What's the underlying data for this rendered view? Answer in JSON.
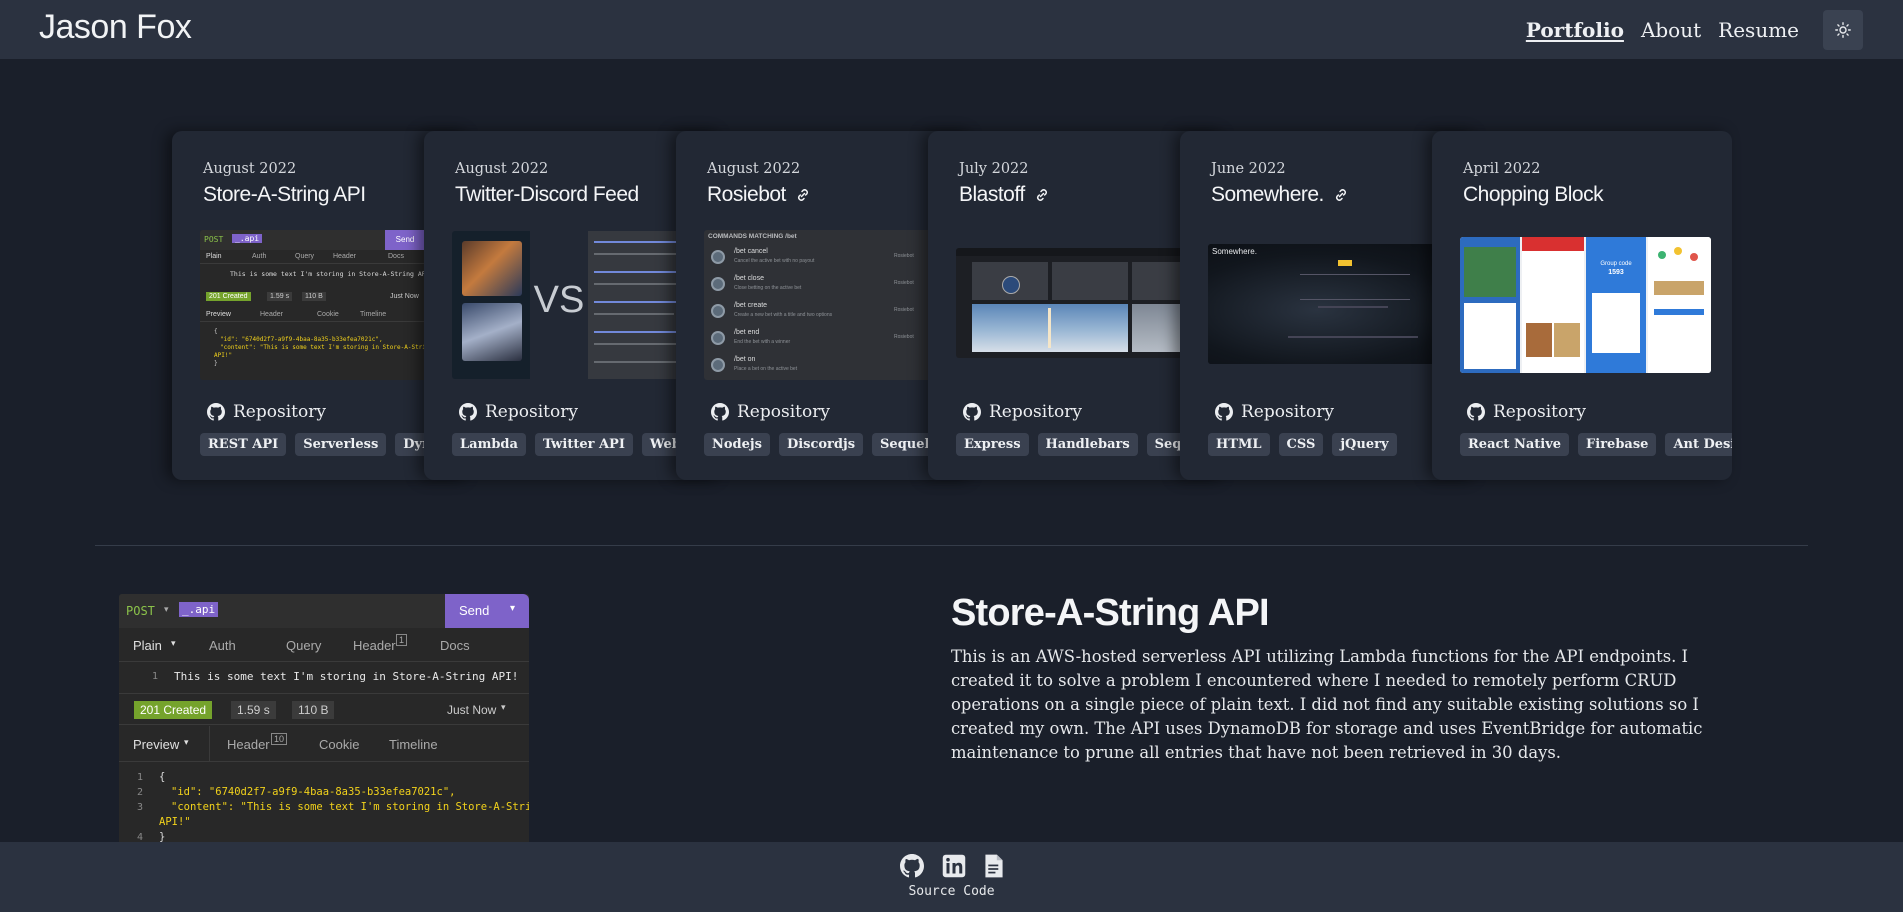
{
  "brand": "Jason Fox",
  "nav": {
    "portfolio": "Portfolio",
    "about": "About",
    "resume": "Resume"
  },
  "theme_toggle_icon": "sun-icon",
  "repo_label": "Repository",
  "cards": [
    {
      "date": "August 2022",
      "title": "Store-A-String API",
      "tags": [
        "REST API",
        "Serverless",
        "DynamoDB"
      ]
    },
    {
      "date": "August 2022",
      "title": "Twitter-Discord Feed",
      "vs": "VS",
      "tags": [
        "Lambda",
        "Twitter API",
        "Webhooks"
      ]
    },
    {
      "date": "August 2022",
      "title": "Rosiebot",
      "tags": [
        "Nodejs",
        "Discordjs",
        "Sequelize"
      ]
    },
    {
      "date": "July 2022",
      "title": "Blastoff",
      "tags": [
        "Express",
        "Handlebars",
        "Sequelize"
      ]
    },
    {
      "date": "June 2022",
      "title": "Somewhere.",
      "tags": [
        "HTML",
        "CSS",
        "jQuery"
      ]
    },
    {
      "date": "April 2022",
      "title": "Chopping Block",
      "tags": [
        "React Native",
        "Firebase",
        "Ant Design"
      ]
    }
  ],
  "detail": {
    "title": "Store-A-String API",
    "description": "This is an AWS-hosted serverless API utilizing Lambda functions for the API endpoints. I created it to solve a problem I encountered where I needed to remotely perform CRUD operations on a single piece of plain text. I did not find any suitable existing solutions so I created my own. The API uses DynamoDB for storage and uses EventBridge for automatic maintenance to prune all entries that have not been retrieved in 30 days.",
    "shot": {
      "method": "POST",
      "url": "_.api",
      "send": "Send",
      "req_tabs": [
        "Plain",
        "Auth",
        "Query",
        "Header",
        "Docs"
      ],
      "header_count": "1",
      "body_line": "This is some text I'm storing in Store-A-String API!",
      "status": "201 Created",
      "time": "1.59 s",
      "size": "110 B",
      "when": "Just Now",
      "resp_tabs": [
        "Preview",
        "Header",
        "Cookie",
        "Timeline"
      ],
      "resp_header_count": "10",
      "resp_lines": [
        "{",
        "\"id\": \"6740d2f7-a9f9-4baa-8a35-b33efea7021c\",",
        "\"content\": \"This is some text I'm storing in Store-A-String",
        "API!\"",
        "}"
      ]
    }
  },
  "rosie_commands": [
    {
      "cmd": "/bet cancel",
      "desc": "Cancel the active bet with no payout"
    },
    {
      "cmd": "/bet close",
      "desc": "Close betting on the active bet"
    },
    {
      "cmd": "/bet create",
      "desc": "Create a new bet with a title and two options"
    },
    {
      "cmd": "/bet end",
      "desc": "End the bet with a winner"
    },
    {
      "cmd": "/bet on",
      "desc": "Place a bet on the active bet"
    }
  ],
  "rosie_header": "COMMANDS MATCHING /bet",
  "rosie_app": "Rosiebot",
  "somewhere_brand": "Somewhere.",
  "chopping_code_label": "Group code",
  "chopping_code": "1593",
  "footer": {
    "label": "Source Code"
  },
  "colors": {
    "bg": "#1a1f2a",
    "bar": "#2b3240",
    "card": "#222834",
    "tag": "#3a4150",
    "send": "#7e63c9",
    "created": "#75a32c"
  }
}
